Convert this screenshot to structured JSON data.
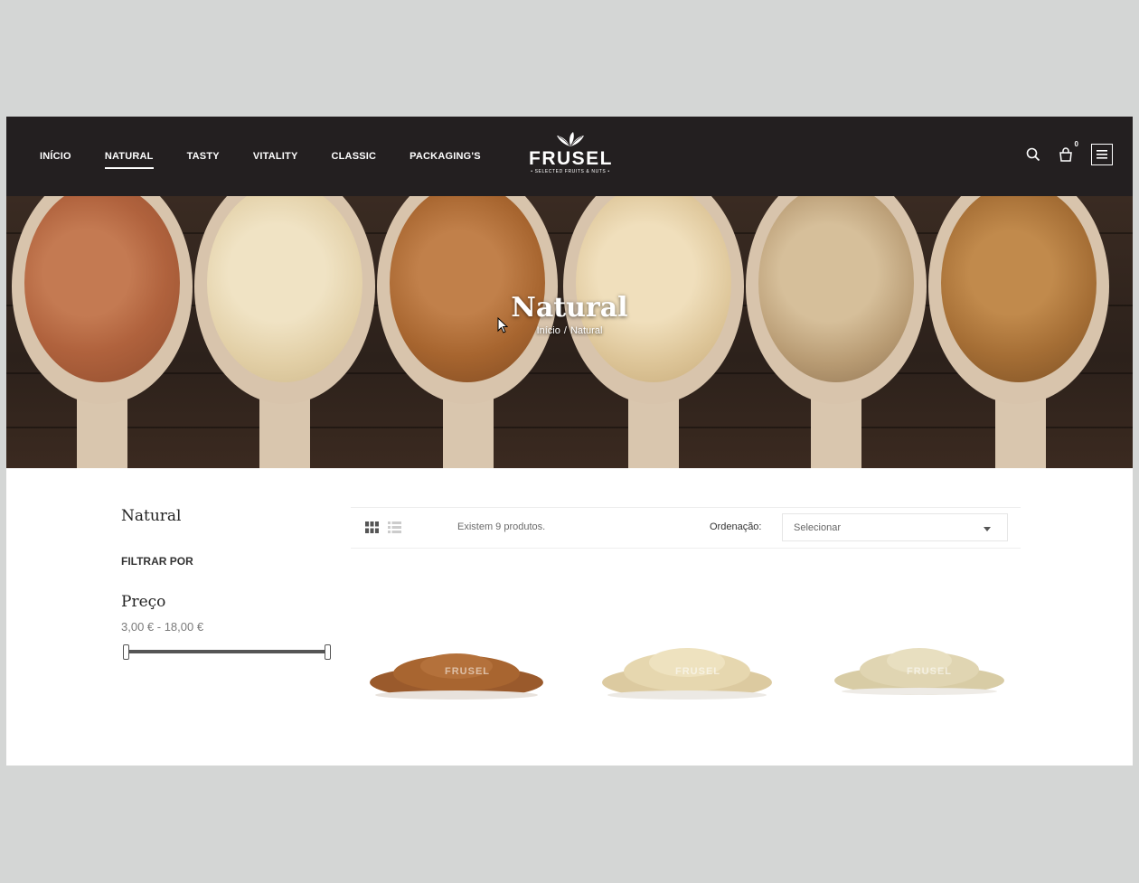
{
  "header": {
    "nav": [
      {
        "label": "INÍCIO",
        "active": false
      },
      {
        "label": "NATURAL",
        "active": true
      },
      {
        "label": "TASTY",
        "active": false
      },
      {
        "label": "VITALITY",
        "active": false
      },
      {
        "label": "CLASSIC",
        "active": false
      },
      {
        "label": "PACKAGING'S",
        "active": false
      }
    ],
    "logo": {
      "brand": "FRUSEL",
      "tagline": "• SELECTED FRUITS & NUTS •"
    },
    "cart_count": "0",
    "icons": [
      "search-icon",
      "cart-icon",
      "menu-icon"
    ]
  },
  "hero": {
    "title": "Natural",
    "breadcrumb": {
      "home": "Início",
      "separator": "/",
      "current": "Natural"
    }
  },
  "sidebar": {
    "category_title": "Natural",
    "filter_heading": "FILTRAR POR",
    "price_title": "Preço",
    "price_range": "3,00 € - 18,00 €",
    "price_min": 3.0,
    "price_max": 18.0
  },
  "toolbar": {
    "product_count": "Existem 9 produtos.",
    "sort_label": "Ordenação:",
    "sort_value": "Selecionar"
  },
  "products": [
    {
      "watermark": "FRUSEL",
      "color": "#9a5a2c"
    },
    {
      "watermark": "FRUSEL",
      "color": "#e3d3a6"
    },
    {
      "watermark": "FRUSEL",
      "color": "#ddd2ad"
    }
  ],
  "colors": {
    "header_bg": "#231f20",
    "page_bg": "#d4d6d5",
    "slider": "#555555"
  }
}
